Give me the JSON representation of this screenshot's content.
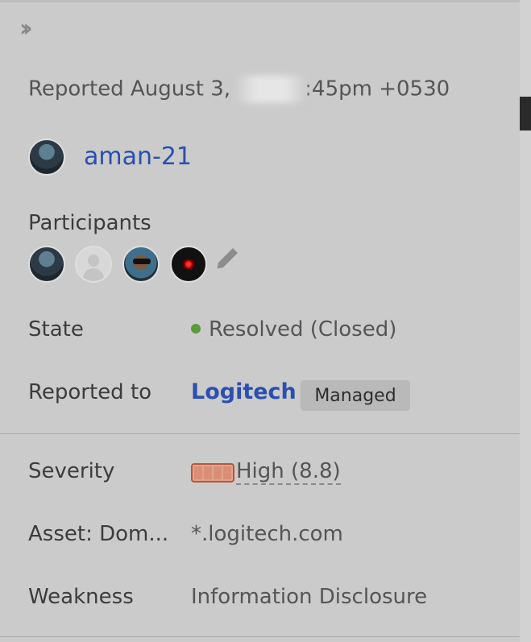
{
  "header": {
    "collapse_icon": "double-chevron-right-icon"
  },
  "report": {
    "reported_prefix": "Reported August 3, ",
    "reported_suffix": ":45pm +0530"
  },
  "reporter": {
    "username": "aman-21"
  },
  "participants": {
    "label": "Participants",
    "edit_icon": "pencil-icon"
  },
  "state": {
    "label": "State",
    "value": "Resolved (Closed)",
    "status_color": "#5a9b3a"
  },
  "reported_to": {
    "label": "Reported to",
    "program": "Logitech",
    "badge": "Managed"
  },
  "severity": {
    "label": "Severity",
    "value": "High (8.8)",
    "color": "#b65740",
    "segments_filled": 4,
    "segments_total": 4
  },
  "asset": {
    "label": "Asset: Dom...",
    "value": "*.logitech.com"
  },
  "weakness": {
    "label": "Weakness",
    "value": "Information Disclosure"
  },
  "colors": {
    "link": "#2b4fb0",
    "panel_bg": "#cbcbcb"
  }
}
